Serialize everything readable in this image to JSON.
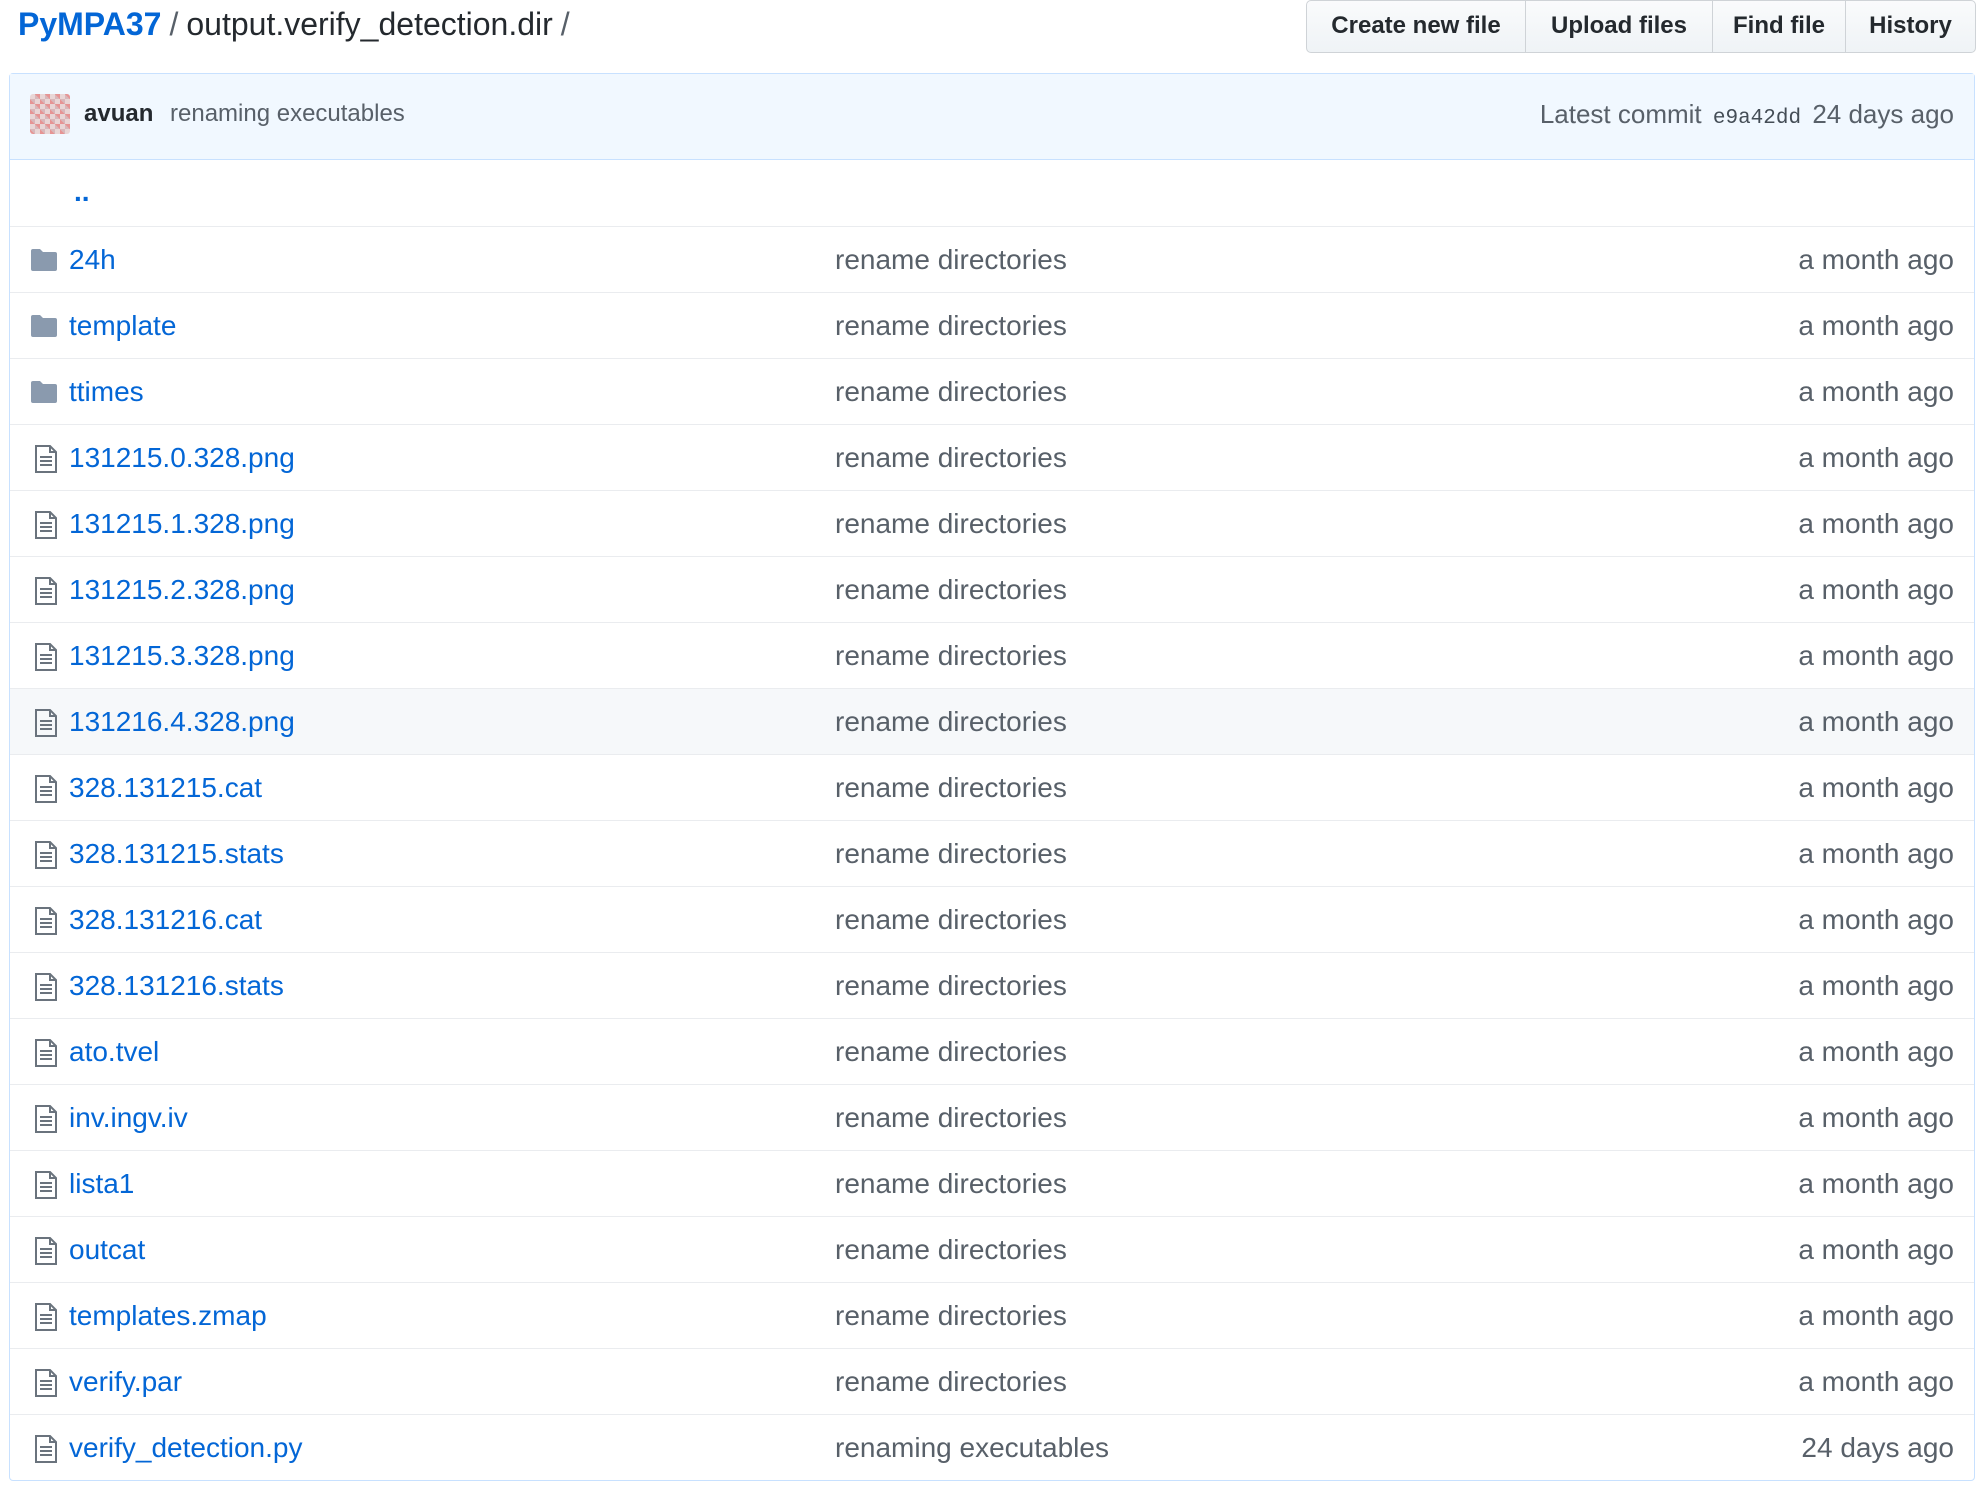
{
  "breadcrumb": {
    "repo": "PyMPA37",
    "separator": "/",
    "directory": "output.verify_detection.dir",
    "trailing_separator": "/"
  },
  "toolbar": {
    "create_label": "Create new file",
    "upload_label": "Upload files",
    "find_label": "Find file",
    "history_label": "History"
  },
  "commit": {
    "author": "avuan",
    "message": "renaming executables",
    "latest_label": "Latest commit",
    "sha": "e9a42dd",
    "age": "24 days ago"
  },
  "parent_link": "..",
  "files": [
    {
      "name": "24h",
      "type": "folder",
      "message": "rename directories",
      "age": "a month ago"
    },
    {
      "name": "template",
      "type": "folder",
      "message": "rename directories",
      "age": "a month ago"
    },
    {
      "name": "ttimes",
      "type": "folder",
      "message": "rename directories",
      "age": "a month ago"
    },
    {
      "name": "131215.0.328.png",
      "type": "file",
      "message": "rename directories",
      "age": "a month ago"
    },
    {
      "name": "131215.1.328.png",
      "type": "file",
      "message": "rename directories",
      "age": "a month ago"
    },
    {
      "name": "131215.2.328.png",
      "type": "file",
      "message": "rename directories",
      "age": "a month ago"
    },
    {
      "name": "131215.3.328.png",
      "type": "file",
      "message": "rename directories",
      "age": "a month ago"
    },
    {
      "name": "131216.4.328.png",
      "type": "file",
      "message": "rename directories",
      "age": "a month ago"
    },
    {
      "name": "328.131215.cat",
      "type": "file",
      "message": "rename directories",
      "age": "a month ago"
    },
    {
      "name": "328.131215.stats",
      "type": "file",
      "message": "rename directories",
      "age": "a month ago"
    },
    {
      "name": "328.131216.cat",
      "type": "file",
      "message": "rename directories",
      "age": "a month ago"
    },
    {
      "name": "328.131216.stats",
      "type": "file",
      "message": "rename directories",
      "age": "a month ago"
    },
    {
      "name": "ato.tvel",
      "type": "file",
      "message": "rename directories",
      "age": "a month ago"
    },
    {
      "name": "inv.ingv.iv",
      "type": "file",
      "message": "rename directories",
      "age": "a month ago"
    },
    {
      "name": "lista1",
      "type": "file",
      "message": "rename directories",
      "age": "a month ago"
    },
    {
      "name": "outcat",
      "type": "file",
      "message": "rename directories",
      "age": "a month ago"
    },
    {
      "name": "templates.zmap",
      "type": "file",
      "message": "rename directories",
      "age": "a month ago"
    },
    {
      "name": "verify.par",
      "type": "file",
      "message": "rename directories",
      "age": "a month ago"
    },
    {
      "name": "verify_detection.py",
      "type": "file",
      "message": "renaming executables",
      "age": "24 days ago"
    }
  ],
  "colors": {
    "link": "#0366d6",
    "muted": "#586069",
    "commit_bg": "#f1f8ff",
    "folder_icon": "#79b8ff",
    "file_icon": "#6a737d",
    "row_highlight": "#f6f8fa"
  }
}
